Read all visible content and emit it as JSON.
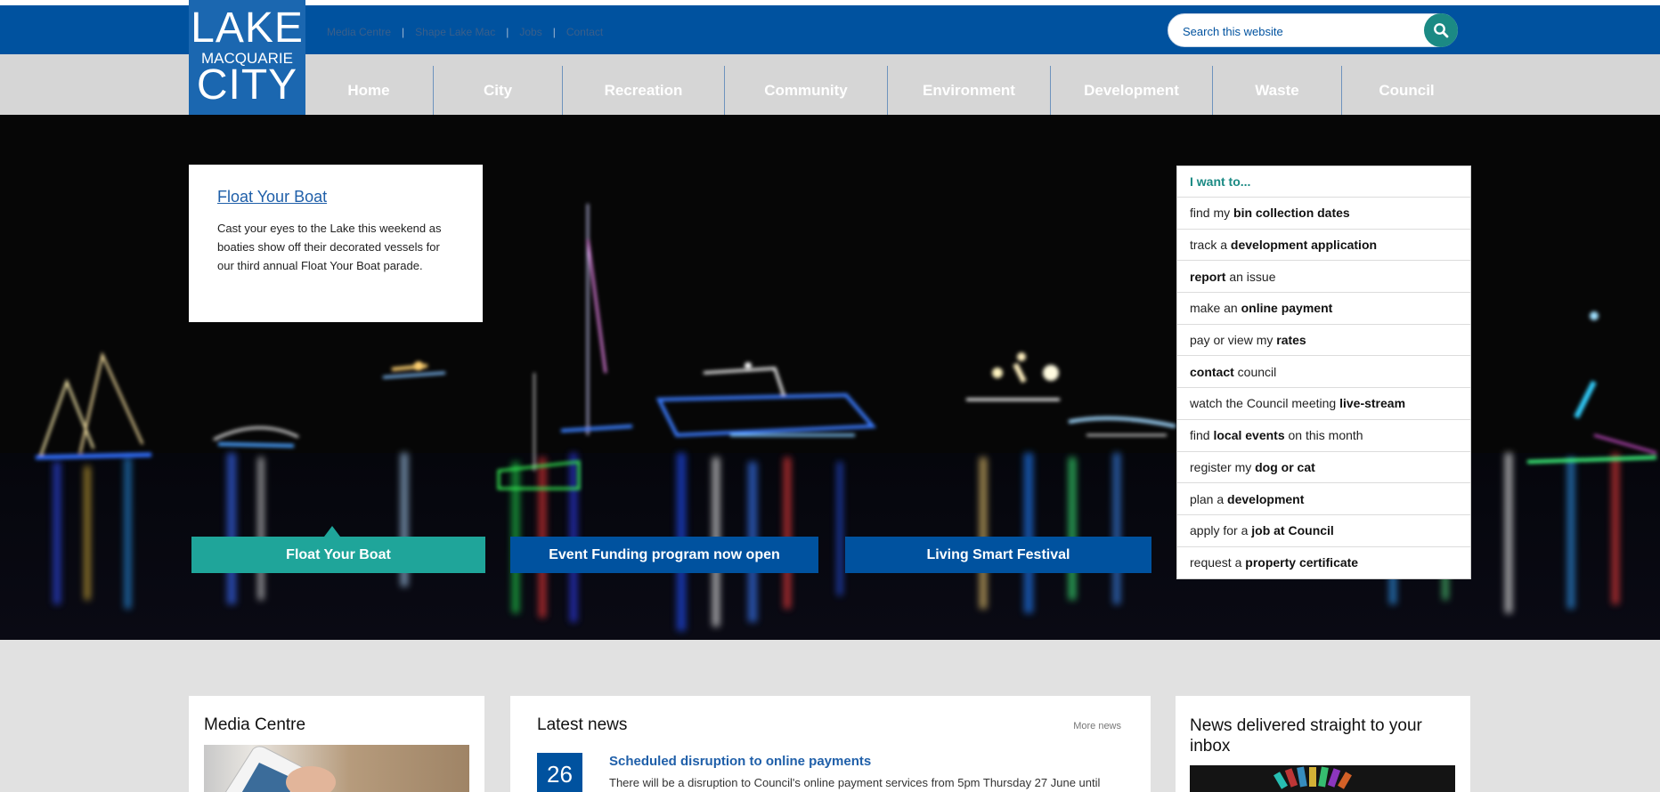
{
  "header": {
    "util_links": [
      "Media Centre",
      "Shape Lake Mac",
      "Jobs",
      "Contact"
    ],
    "search": {
      "placeholder": "Search this website",
      "icon": "search-icon"
    },
    "logo": {
      "line1": "LAKE",
      "line2": "MACQUARIE",
      "line3": "CITY"
    }
  },
  "nav": {
    "items": [
      "Home",
      "City",
      "Recreation",
      "Community",
      "Environment",
      "Development",
      "Waste",
      "Council"
    ]
  },
  "hero": {
    "feature": {
      "title": "Float Your Boat",
      "text": "Cast your eyes to the Lake this weekend as boaties show off their decorated vessels for our third annual Float Your Boat parade."
    },
    "tabs": [
      "Float Your Boat",
      "Event Funding program now open",
      "Living Smart Festival"
    ],
    "active_tab": 0
  },
  "iwant": {
    "heading": "I want to...",
    "items": [
      {
        "pre": "find my ",
        "bold": "bin collection dates",
        "post": ""
      },
      {
        "pre": "track a ",
        "bold": "development application",
        "post": ""
      },
      {
        "pre": "",
        "bold": "report",
        "post": " an issue"
      },
      {
        "pre": "make an ",
        "bold": "online payment",
        "post": ""
      },
      {
        "pre": "pay or view my ",
        "bold": "rates",
        "post": ""
      },
      {
        "pre": "",
        "bold": "contact",
        "post": " council"
      },
      {
        "pre": "watch the Council meeting ",
        "bold": "live-stream",
        "post": ""
      },
      {
        "pre": "find ",
        "bold": "local events",
        "post": " on this month"
      },
      {
        "pre": "register my ",
        "bold": "dog or cat",
        "post": ""
      },
      {
        "pre": "plan a ",
        "bold": "development",
        "post": ""
      },
      {
        "pre": "apply for a ",
        "bold": "job at Council",
        "post": ""
      },
      {
        "pre": "request a ",
        "bold": "property certificate",
        "post": ""
      }
    ]
  },
  "media": {
    "title": "Media Centre"
  },
  "news": {
    "title": "Latest news",
    "more": "More news",
    "item": {
      "day": "26",
      "title": "Scheduled disruption to online payments",
      "text": "There will be a disruption to Council's online payment services from 5pm Thursday 27 June until"
    }
  },
  "inbox": {
    "title": "News delivered straight to your inbox"
  },
  "colors": {
    "brand_blue": "#00529f",
    "teal": "#1fa59a",
    "nav_grey": "#d6d6d6"
  }
}
